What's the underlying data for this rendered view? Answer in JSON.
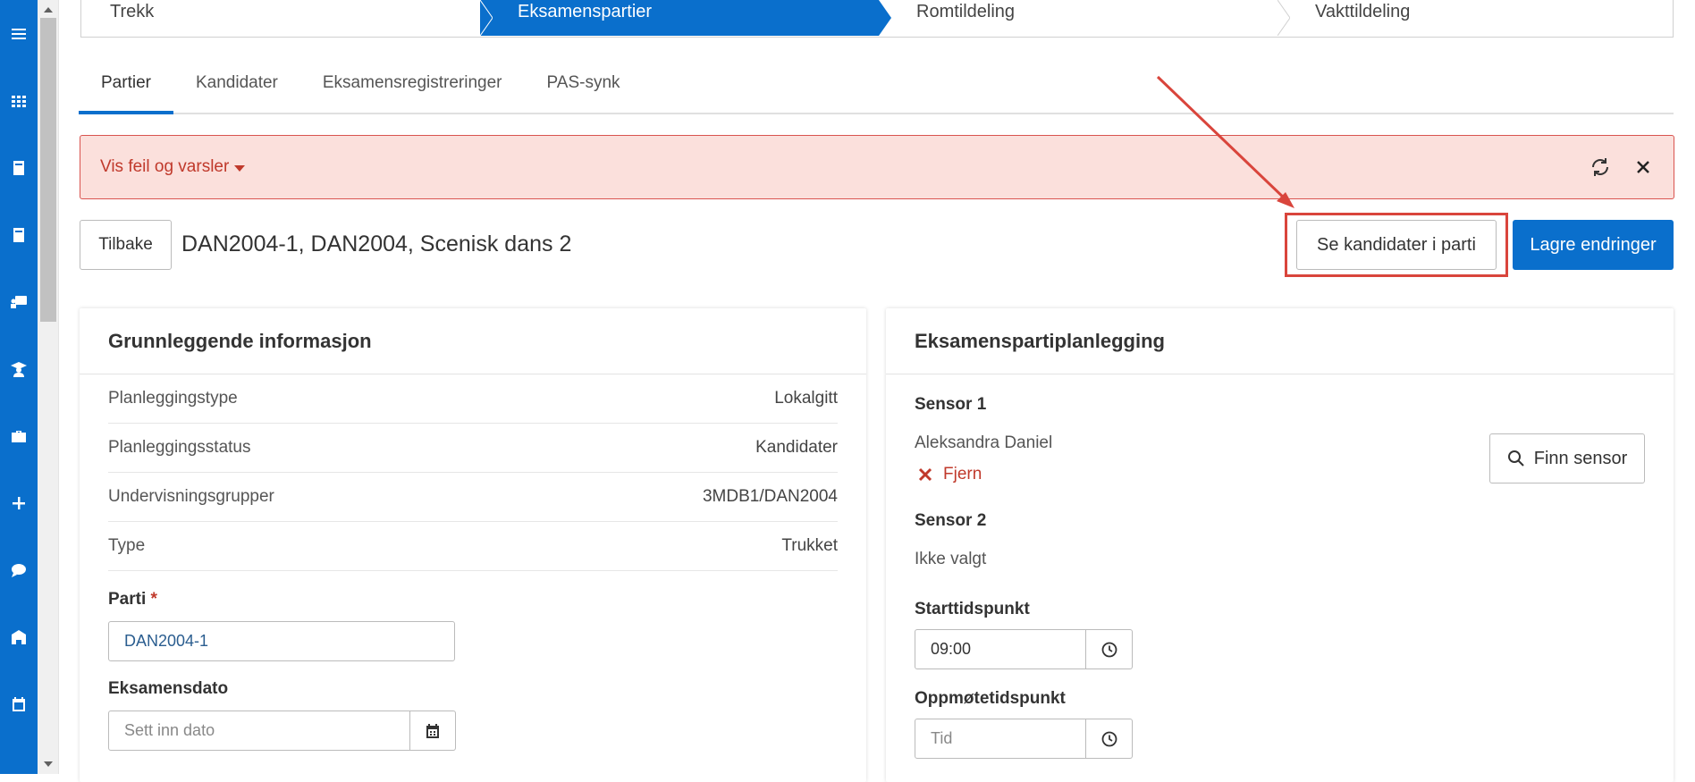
{
  "stepper": {
    "steps": [
      "Trekk",
      "Eksamenspartier",
      "Romtildeling",
      "Vakttildeling"
    ],
    "active_index": 1
  },
  "tabs": [
    "Partier",
    "Kandidater",
    "Eksamensregistreringer",
    "PAS-synk"
  ],
  "alert": {
    "toggle_label": "Vis feil og varsler"
  },
  "header": {
    "back_label": "Tilbake",
    "title": "DAN2004-1, DAN2004, Scenisk dans 2",
    "see_candidates_label": "Se kandidater i parti",
    "save_label": "Lagre endringer"
  },
  "basic_info": {
    "title": "Grunnleggende informasjon",
    "rows": [
      {
        "label": "Planleggingstype",
        "value": "Lokalgitt"
      },
      {
        "label": "Planleggingsstatus",
        "value": "Kandidater"
      },
      {
        "label": "Undervisningsgrupper",
        "value": "3MDB1/DAN2004"
      },
      {
        "label": "Type",
        "value": "Trukket"
      }
    ],
    "parti_label": "Parti",
    "parti_required": "*",
    "parti_value": "DAN2004-1",
    "date_label": "Eksamensdato",
    "date_placeholder": "Sett inn dato"
  },
  "planning": {
    "title": "Eksamenspartiplanlegging",
    "sensor1_label": "Sensor 1",
    "sensor1_name": "Aleksandra Daniel",
    "remove_label": "Fjern",
    "find_sensor_label": "Finn sensor",
    "sensor2_label": "Sensor 2",
    "sensor2_value": "Ikke valgt",
    "start_label": "Starttidspunkt",
    "start_value": "09:00",
    "attend_label": "Oppmøtetidspunkt",
    "attend_placeholder": "Tid"
  },
  "colors": {
    "primary": "#0a6fcc",
    "danger": "#c0392b",
    "alert_bg": "#fbe0dc",
    "annotation": "#d9453c"
  },
  "icons": {
    "sidebar": [
      "menu-icon",
      "grid-icon",
      "book-icon",
      "book-icon",
      "teacher-icon",
      "graduate-icon",
      "briefcase-icon",
      "plus-icon",
      "chat-icon",
      "school-icon",
      "calendar-icon"
    ]
  }
}
